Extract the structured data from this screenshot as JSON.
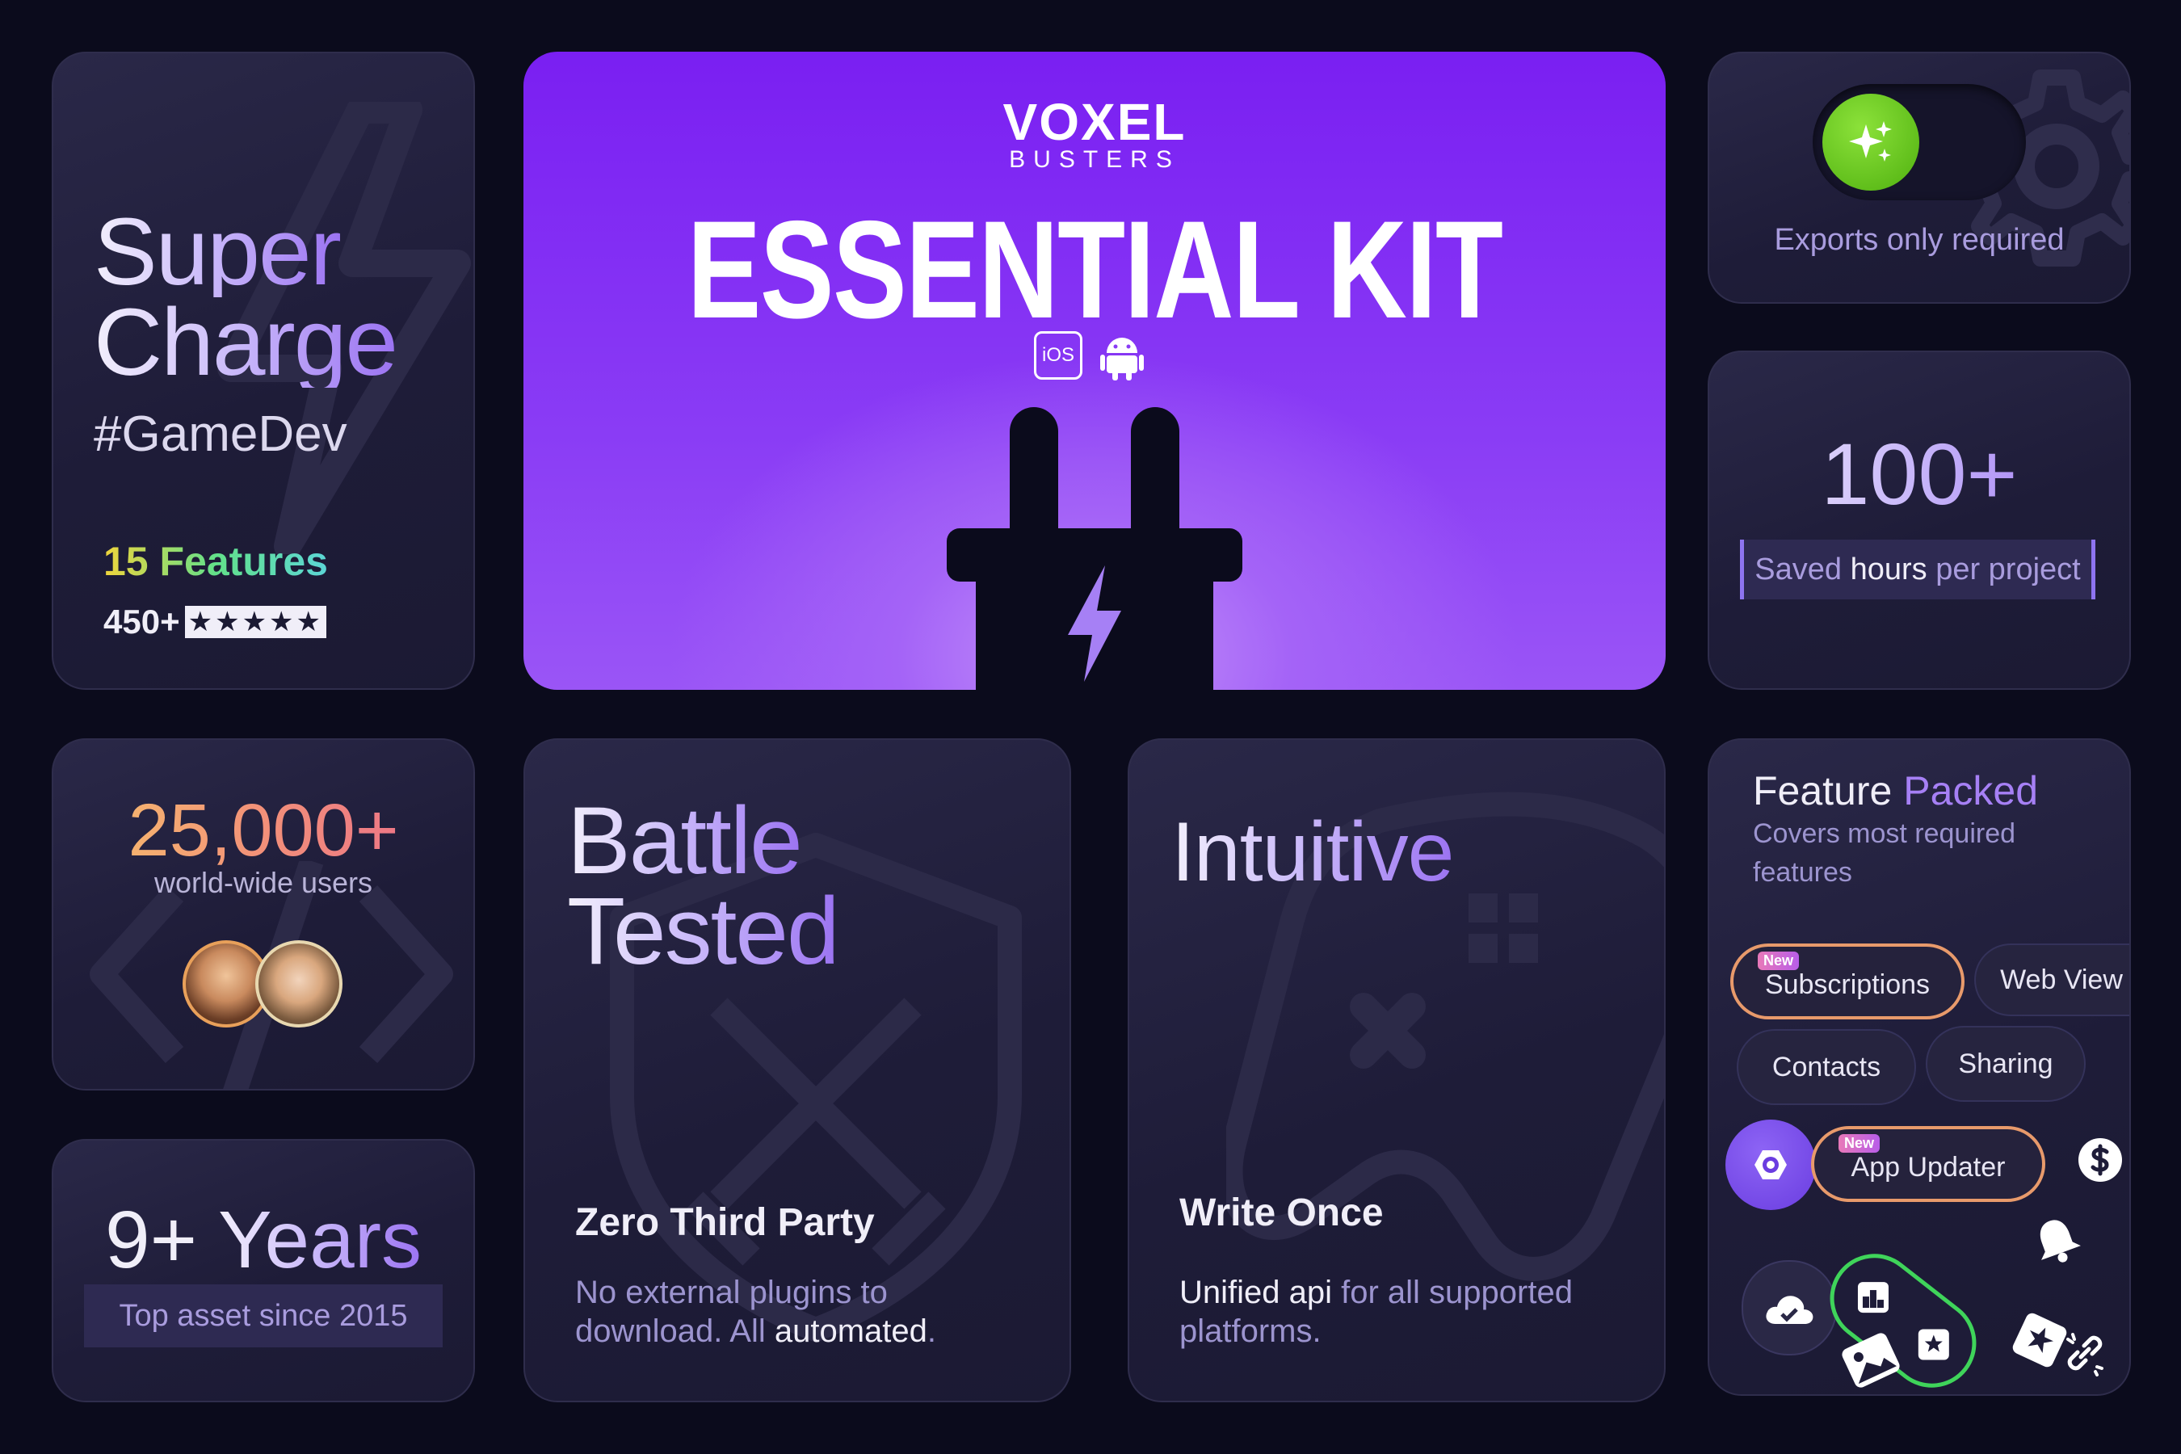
{
  "supercharge": {
    "line1": "Super",
    "line2": "Charge",
    "hashtag": "#GameDev",
    "features": "15 Features",
    "rating_count": "450+",
    "stars": "★★★★★"
  },
  "hero": {
    "brand_top": "VOXEL",
    "brand_bottom": "BUSTERS",
    "title": "ESSENTIAL KIT",
    "ios_label": "iOS"
  },
  "exports": {
    "text": "Exports only required"
  },
  "saved": {
    "number": "100+",
    "text_pre": "Saved ",
    "text_mid": "hours",
    "text_post": " per project"
  },
  "users": {
    "count": "25,000+",
    "label": "world-wide users"
  },
  "years": {
    "title_num": "9+",
    "title_word": "Years",
    "subtitle": "Top asset since 2015"
  },
  "battle": {
    "line1": "Battle",
    "line2": "Tested",
    "heading": "Zero Third Party",
    "desc_part1": "No external plugins to download. All ",
    "desc_part2": "automated",
    "desc_part3": "."
  },
  "intuitive": {
    "title": "Intuitive",
    "heading": "Write Once",
    "desc_part1": "Unified api",
    "desc_part2": " for all supported platforms."
  },
  "features": {
    "title_a": "Feature",
    "title_b": "Packed",
    "subtitle": "Covers most required features",
    "new_badge": "New",
    "chips": {
      "subscriptions": "Subscriptions",
      "webview": "Web View",
      "contacts": "Contacts",
      "sharing": "Sharing",
      "app_updater": "App Updater"
    }
  },
  "colors": {
    "background": "#0b0b1c",
    "hero": "#8a3cf5",
    "accent": "#a680f5",
    "green": "#5ec21a",
    "orange": "#e89a6b"
  }
}
